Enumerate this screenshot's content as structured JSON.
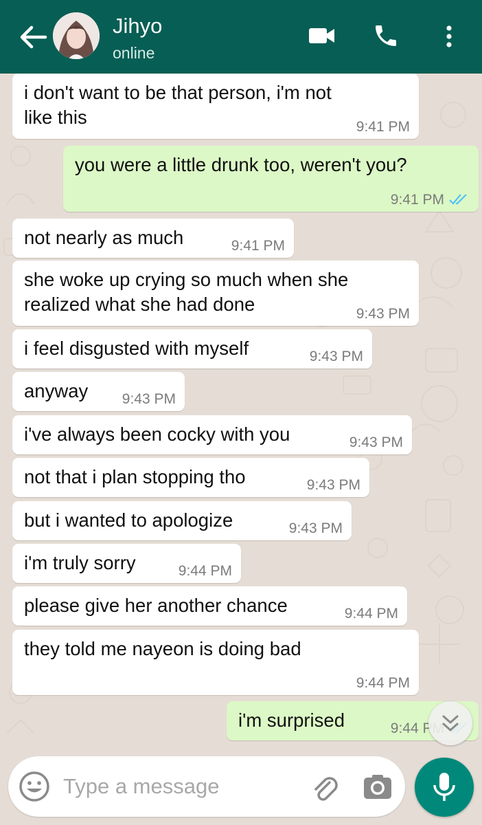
{
  "header": {
    "contact_name": "Jihyo",
    "status": "online",
    "back_icon": "arrow-left-icon",
    "video_icon": "video-call-icon",
    "call_icon": "phone-icon",
    "menu_icon": "more-vert-icon",
    "color": "#075e54"
  },
  "messages": [
    {
      "dir": "in",
      "text": "i don't want to be that person, i'm not\nlike this",
      "time": "9:41 PM"
    },
    {
      "dir": "out",
      "text": "you were a little drunk too, weren't you?",
      "time": "9:41 PM",
      "read": true
    },
    {
      "dir": "in",
      "text": "not nearly as much",
      "time": "9:41 PM"
    },
    {
      "dir": "in",
      "text": "she woke up crying so much when she\nrealized what she had done",
      "time": "9:43 PM"
    },
    {
      "dir": "in",
      "text": "i feel disgusted with myself",
      "time": "9:43 PM"
    },
    {
      "dir": "in",
      "text": "anyway",
      "time": "9:43 PM"
    },
    {
      "dir": "in",
      "text": "i've always been cocky with you",
      "time": "9:43 PM"
    },
    {
      "dir": "in",
      "text": "not that i plan stopping tho",
      "time": "9:43 PM"
    },
    {
      "dir": "in",
      "text": "but i wanted to apologize",
      "time": "9:43 PM"
    },
    {
      "dir": "in",
      "text": "i'm truly sorry",
      "time": "9:44 PM"
    },
    {
      "dir": "in",
      "text": "please give her another chance",
      "time": "9:44 PM"
    },
    {
      "dir": "in",
      "text": "they told me nayeon is doing bad",
      "time": "9:44 PM"
    },
    {
      "dir": "out",
      "text": "i'm surprised",
      "time": "9:44 PM",
      "read": true
    }
  ],
  "composer": {
    "placeholder": "Type a message",
    "emoji_icon": "emoji-icon",
    "attach_icon": "paperclip-icon",
    "camera_icon": "camera-icon",
    "mic_icon": "mic-icon",
    "accent": "#00897b"
  },
  "scroll_icon": "double-chevron-down-icon",
  "colors": {
    "incoming": "#ffffff",
    "outgoing": "#dcf8c6",
    "read_tick": "#4fc3f7",
    "wallpaper": "#e5ddd5"
  }
}
